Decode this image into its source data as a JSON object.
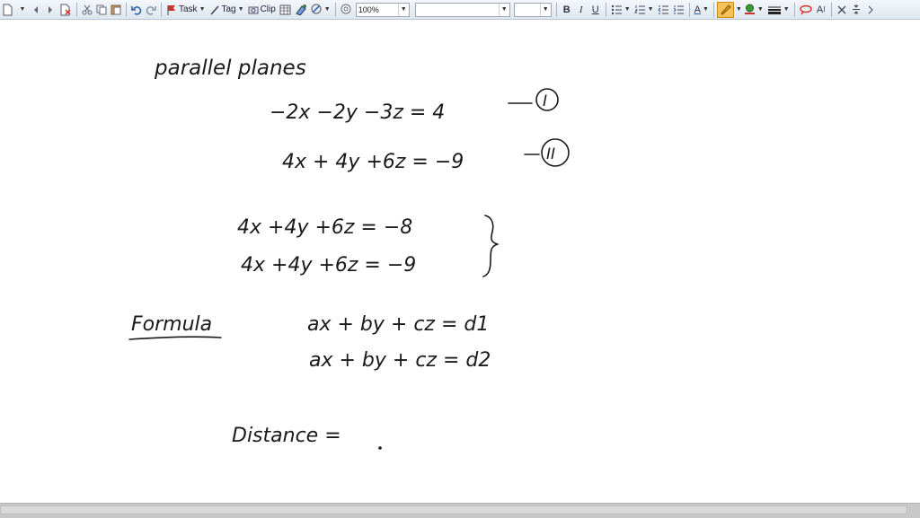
{
  "toolbar": {
    "task_label": "Task",
    "tag_label": "Tag",
    "clip_label": "Clip",
    "zoom_value": "100%",
    "font_name_value": "",
    "font_size_value": "",
    "bold_label": "B",
    "italic_label": "I",
    "underline_label": "U",
    "text_color_label": "A",
    "font_a_label": "A"
  },
  "notes": {
    "heading": "parallel planes",
    "eq1": "−2x −2y −3z = 4",
    "eq1_marker": "I",
    "eq2": "4x + 4y +6z = −9",
    "eq2_marker": "II",
    "eq3": "4x +4y +6z = −8",
    "eq4": "4x +4y +6z = −9",
    "formula_label": "Formula",
    "formula1": "ax + by + cz = d1",
    "formula2": "ax + by + cz = d2",
    "distance_label": "Distance ="
  },
  "colors": {
    "ink": "#1a1a1a",
    "toolbar_top": "#f4f7fb",
    "toolbar_bottom": "#dfe6ef",
    "highlighter": "#f5a623",
    "pen_red": "#d0312d",
    "bottom_bar": "#c8c8c8"
  }
}
